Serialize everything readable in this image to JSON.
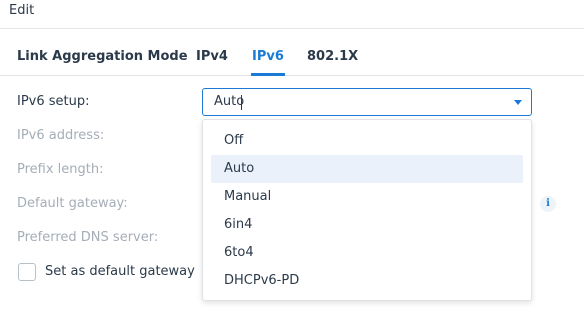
{
  "window": {
    "title": "Edit"
  },
  "tabs": [
    {
      "label": "Link Aggregation Mode",
      "active": false
    },
    {
      "label": "IPv4",
      "active": false
    },
    {
      "label": "IPv6",
      "active": true
    },
    {
      "label": "802.1X",
      "active": false
    }
  ],
  "form": {
    "ipv6_setup_label": "IPv6 setup:",
    "ipv6_setup_value": "Auto",
    "ipv6_address_label": "IPv6 address:",
    "prefix_length_label": "Prefix length:",
    "default_gateway_label": "Default gateway:",
    "preferred_dns_label": "Preferred DNS server:",
    "set_default_gateway_label": "Set as default gateway",
    "set_default_gateway_checked": false
  },
  "dropdown": {
    "options": [
      "Off",
      "Auto",
      "Manual",
      "6in4",
      "6to4",
      "DHCPv6-PD"
    ],
    "selected": "Auto"
  },
  "icons": {
    "info": "info-icon",
    "dropdown_arrow": "chevron-down-icon"
  },
  "colors": {
    "accent": "#1a7bd6",
    "text": "#2b3a4a",
    "disabled_text": "#a5adb6",
    "selected_bg": "#eaf1fa"
  }
}
